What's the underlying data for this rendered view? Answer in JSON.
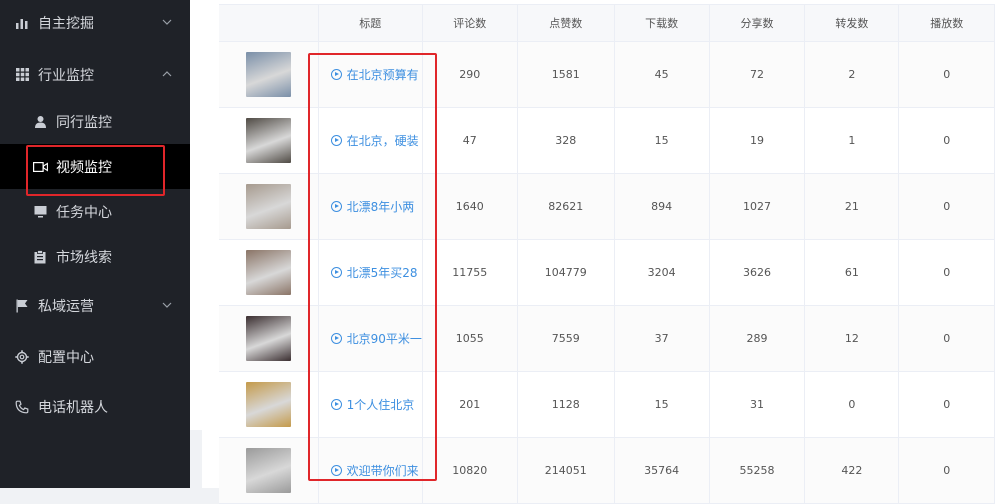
{
  "sidebar": {
    "items": [
      {
        "label": "自主挖掘",
        "icon": "bar-chart-icon",
        "level": "top",
        "expanded": false
      },
      {
        "label": "行业监控",
        "icon": "grid-icon",
        "level": "top",
        "expanded": true
      },
      {
        "label": "同行监控",
        "icon": "user-icon",
        "level": "sub"
      },
      {
        "label": "视频监控",
        "icon": "video-icon",
        "level": "sub",
        "active": true
      },
      {
        "label": "任务中心",
        "icon": "monitor-icon",
        "level": "sub"
      },
      {
        "label": "市场线索",
        "icon": "clipboard-icon",
        "level": "sub"
      },
      {
        "label": "私域运营",
        "icon": "flag-icon",
        "level": "top",
        "expanded": false
      },
      {
        "label": "配置中心",
        "icon": "gear-icon",
        "level": "top"
      },
      {
        "label": "电话机器人",
        "icon": "phone-icon",
        "level": "top"
      }
    ]
  },
  "table": {
    "headers": [
      "",
      "标题",
      "评论数",
      "点赞数",
      "下载数",
      "分享数",
      "转发数",
      "播放数"
    ],
    "rows": [
      {
        "title": "在北京预算有",
        "comments": "290",
        "likes": "1581",
        "downloads": "45",
        "shares": "72",
        "forwards": "2",
        "plays": "0",
        "thumb": "#7a8fa8"
      },
      {
        "title": "在北京，硬装",
        "comments": "47",
        "likes": "328",
        "downloads": "15",
        "shares": "19",
        "forwards": "1",
        "plays": "0",
        "thumb": "#4f4a44"
      },
      {
        "title": "北漂8年小两",
        "comments": "1640",
        "likes": "82621",
        "downloads": "894",
        "shares": "1027",
        "forwards": "21",
        "plays": "0",
        "thumb": "#a69a8e"
      },
      {
        "title": "北漂5年买28",
        "comments": "11755",
        "likes": "104779",
        "downloads": "3204",
        "shares": "3626",
        "forwards": "61",
        "plays": "0",
        "thumb": "#8a7466"
      },
      {
        "title": "北京90平米一",
        "comments": "1055",
        "likes": "7559",
        "downloads": "37",
        "shares": "289",
        "forwards": "12",
        "plays": "0",
        "thumb": "#3a2e30"
      },
      {
        "title": "1个人住北京",
        "comments": "201",
        "likes": "1128",
        "downloads": "15",
        "shares": "31",
        "forwards": "0",
        "plays": "0",
        "thumb": "#c49a4a"
      },
      {
        "title": "欢迎带你们来",
        "comments": "10820",
        "likes": "214051",
        "downloads": "35764",
        "shares": "55258",
        "forwards": "422",
        "plays": "0",
        "thumb": "#9a9a9a"
      }
    ]
  },
  "colors": {
    "sidebar_bg": "#1f2228",
    "active_bg": "#000000",
    "highlight": "#e0262a",
    "link": "#3d8fe0"
  }
}
